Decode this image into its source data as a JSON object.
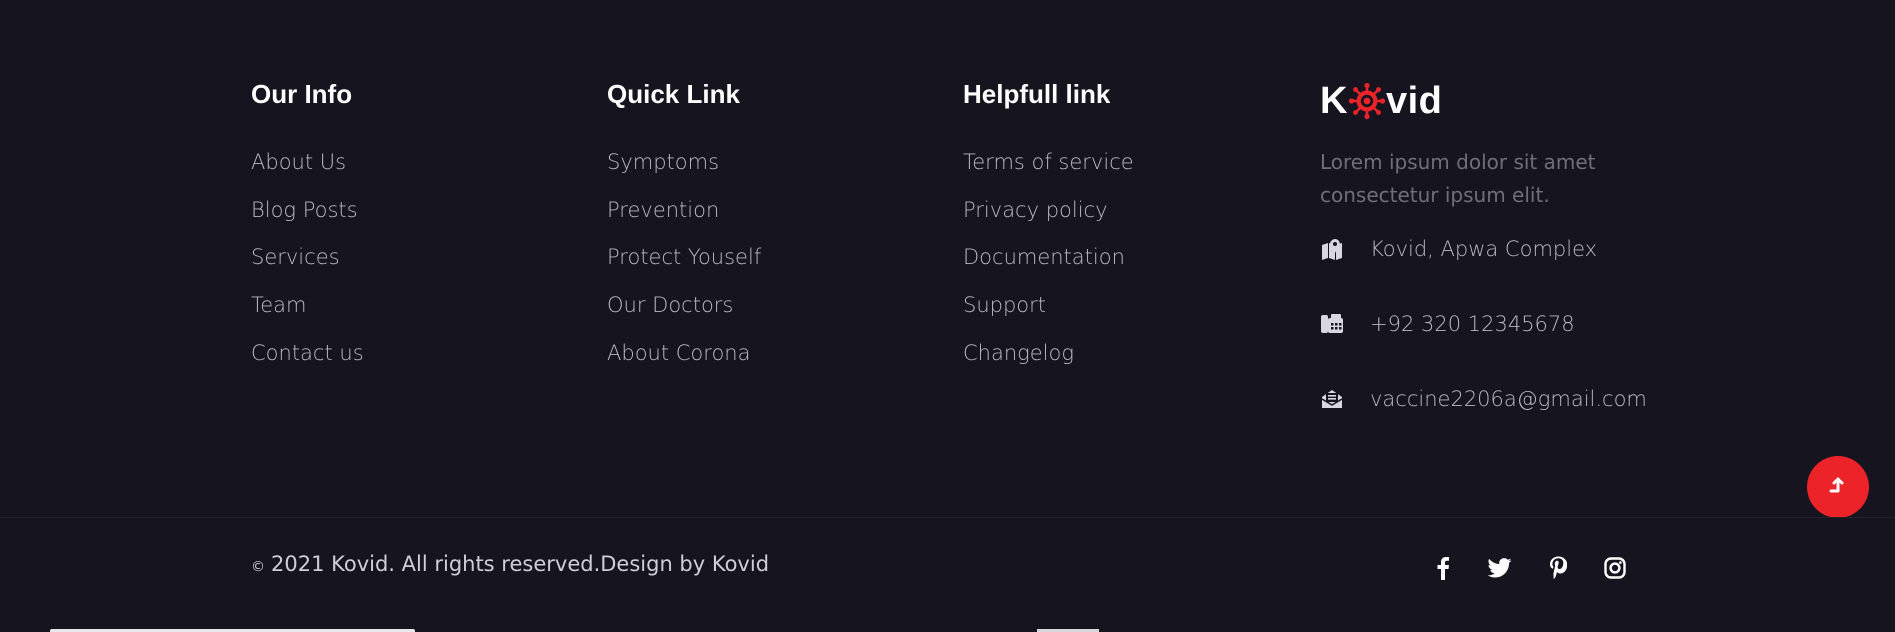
{
  "columns": {
    "our_info": {
      "heading": "Our Info",
      "links": [
        "About Us",
        "Blog Posts",
        "Services",
        "Team",
        "Contact us"
      ]
    },
    "quick_link": {
      "heading": "Quick Link",
      "links": [
        "Symptoms",
        "Prevention",
        "Protect Youself",
        "Our Doctors",
        "About Corona"
      ]
    },
    "helpfull_link": {
      "heading": "Helpfull link",
      "links": [
        "Terms of service",
        "Privacy policy",
        "Documentation",
        "Support",
        "Changelog"
      ]
    }
  },
  "brand": {
    "logo_prefix": "K",
    "logo_suffix": "vid",
    "logo_icon": "virus-icon",
    "description": "Lorem ipsum dolor sit amet consectetur ipsum elit.",
    "contacts": [
      {
        "icon": "map-icon",
        "text": "Kovid, Apwa Complex"
      },
      {
        "icon": "phone-icon",
        "text": "+92 320 12345678"
      },
      {
        "icon": "envelope-icon",
        "text": "vaccine2206a@gmail.com"
      }
    ]
  },
  "footer_bottom": {
    "copyright_symbol": "©",
    "copyright_text": "2021 Kovid. All rights reserved.Design by Kovid"
  },
  "socials": [
    "facebook-icon",
    "twitter-icon",
    "pinterest-icon",
    "instagram-icon"
  ],
  "back_to_top_icon": "arrow-up-icon",
  "colors": {
    "background": "#16151f",
    "accent": "#ec2329",
    "heading": "#ffffff",
    "link": "#b9b8c4",
    "muted": "#6f6e7a"
  }
}
